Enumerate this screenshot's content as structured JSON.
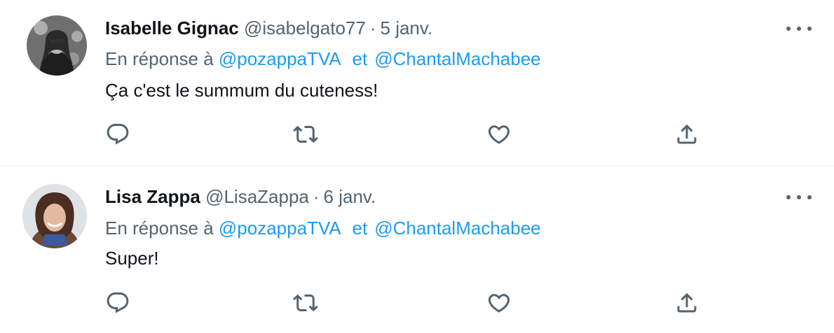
{
  "tweets": [
    {
      "name": "Isabelle Gignac",
      "handle": "@isabelgato77",
      "separator": "·",
      "date": "5 janv.",
      "reply_prefix": "En réponse à",
      "mention_1": "@pozappaTVA",
      "joiner": "et",
      "mention_2": "@ChantalMachabee",
      "text": "Ça c'est le summum du cuteness!",
      "icons": {
        "reply": "reply-icon",
        "retweet": "retweet-icon",
        "like": "like-icon",
        "share": "share-icon",
        "more": "more-icon"
      }
    },
    {
      "name": "Lisa Zappa",
      "handle": "@LisaZappa",
      "separator": "·",
      "date": "6 janv.",
      "reply_prefix": "En réponse à",
      "mention_1": "@pozappaTVA",
      "joiner": "et",
      "mention_2": "@ChantalMachabee",
      "text": "Super!",
      "icons": {
        "reply": "reply-icon",
        "retweet": "retweet-icon",
        "like": "like-icon",
        "share": "share-icon",
        "more": "more-icon"
      }
    }
  ],
  "colors": {
    "primary_text": "#0f1419",
    "secondary_text": "#536471",
    "link": "#1d9bf0",
    "divider": "#eff3f4"
  }
}
